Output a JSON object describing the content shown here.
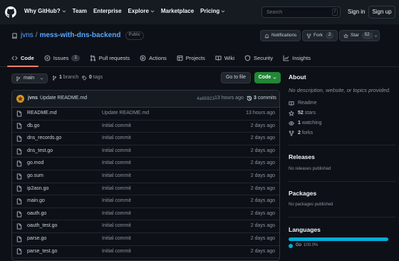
{
  "header": {
    "nav": [
      "Why GitHub?",
      "Team",
      "Enterprise",
      "Explore",
      "Marketplace",
      "Pricing"
    ],
    "search_placeholder": "Search",
    "slash": "/",
    "sign_in": "Sign in",
    "sign_up": "Sign up"
  },
  "repo": {
    "owner": "jvns",
    "sep": "/",
    "name": "mess-with-dns-backend",
    "visibility": "Public",
    "notifications": "Notifications",
    "fork_label": "Fork",
    "fork_count": "2",
    "star_label": "Star",
    "star_count": "52"
  },
  "tabs": [
    {
      "label": "Code",
      "icon": "code-icon"
    },
    {
      "label": "Issues",
      "count": "1",
      "icon": "issue-icon"
    },
    {
      "label": "Pull requests",
      "icon": "pull-request-icon"
    },
    {
      "label": "Actions",
      "icon": "play-icon"
    },
    {
      "label": "Projects",
      "icon": "table-icon"
    },
    {
      "label": "Wiki",
      "icon": "book-icon"
    },
    {
      "label": "Security",
      "icon": "shield-icon"
    },
    {
      "label": "Insights",
      "icon": "graph-icon"
    }
  ],
  "branch": {
    "name": "main",
    "branches_count": "1",
    "branches_label": "branch",
    "tags_count": "0",
    "tags_label": "tags",
    "goto_file": "Go to file",
    "code_button": "Code"
  },
  "latest_commit": {
    "author": "jvns",
    "message": "Update README.md",
    "sha": "4a65823",
    "ago": "13 hours ago",
    "commits_count": "3",
    "commits_label": "commits"
  },
  "files": [
    {
      "name": "README.md",
      "message": "Update README.md",
      "date": "13 hours ago"
    },
    {
      "name": "db.go",
      "message": "Initial commit",
      "date": "2 days ago"
    },
    {
      "name": "dns_records.go",
      "message": "Initial commit",
      "date": "2 days ago"
    },
    {
      "name": "dns_test.go",
      "message": "Initial commit",
      "date": "2 days ago"
    },
    {
      "name": "go.mod",
      "message": "Initial commit",
      "date": "2 days ago"
    },
    {
      "name": "go.sum",
      "message": "Initial commit",
      "date": "2 days ago"
    },
    {
      "name": "ip2asn.go",
      "message": "Initial commit",
      "date": "2 days ago"
    },
    {
      "name": "main.go",
      "message": "Initial commit",
      "date": "2 days ago"
    },
    {
      "name": "oauth.go",
      "message": "Initial commit",
      "date": "2 days ago"
    },
    {
      "name": "oauth_test.go",
      "message": "Initial commit",
      "date": "2 days ago"
    },
    {
      "name": "parse.go",
      "message": "Initial commit",
      "date": "2 days ago"
    },
    {
      "name": "parse_test.go",
      "message": "Initial commit",
      "date": "2 days ago"
    }
  ],
  "about": {
    "title": "About",
    "description": "No description, website, or topics provided.",
    "readme": "Readme",
    "stars_count": "52",
    "stars_label": "stars",
    "watching_count": "1",
    "watching_label": "watching",
    "forks_count": "2",
    "forks_label": "forks"
  },
  "releases": {
    "title": "Releases",
    "note": "No releases published"
  },
  "packages": {
    "title": "Packages",
    "note": "No packages published"
  },
  "languages": {
    "title": "Languages",
    "name": "Go",
    "percent": "100.0%",
    "color": "#00add8"
  }
}
